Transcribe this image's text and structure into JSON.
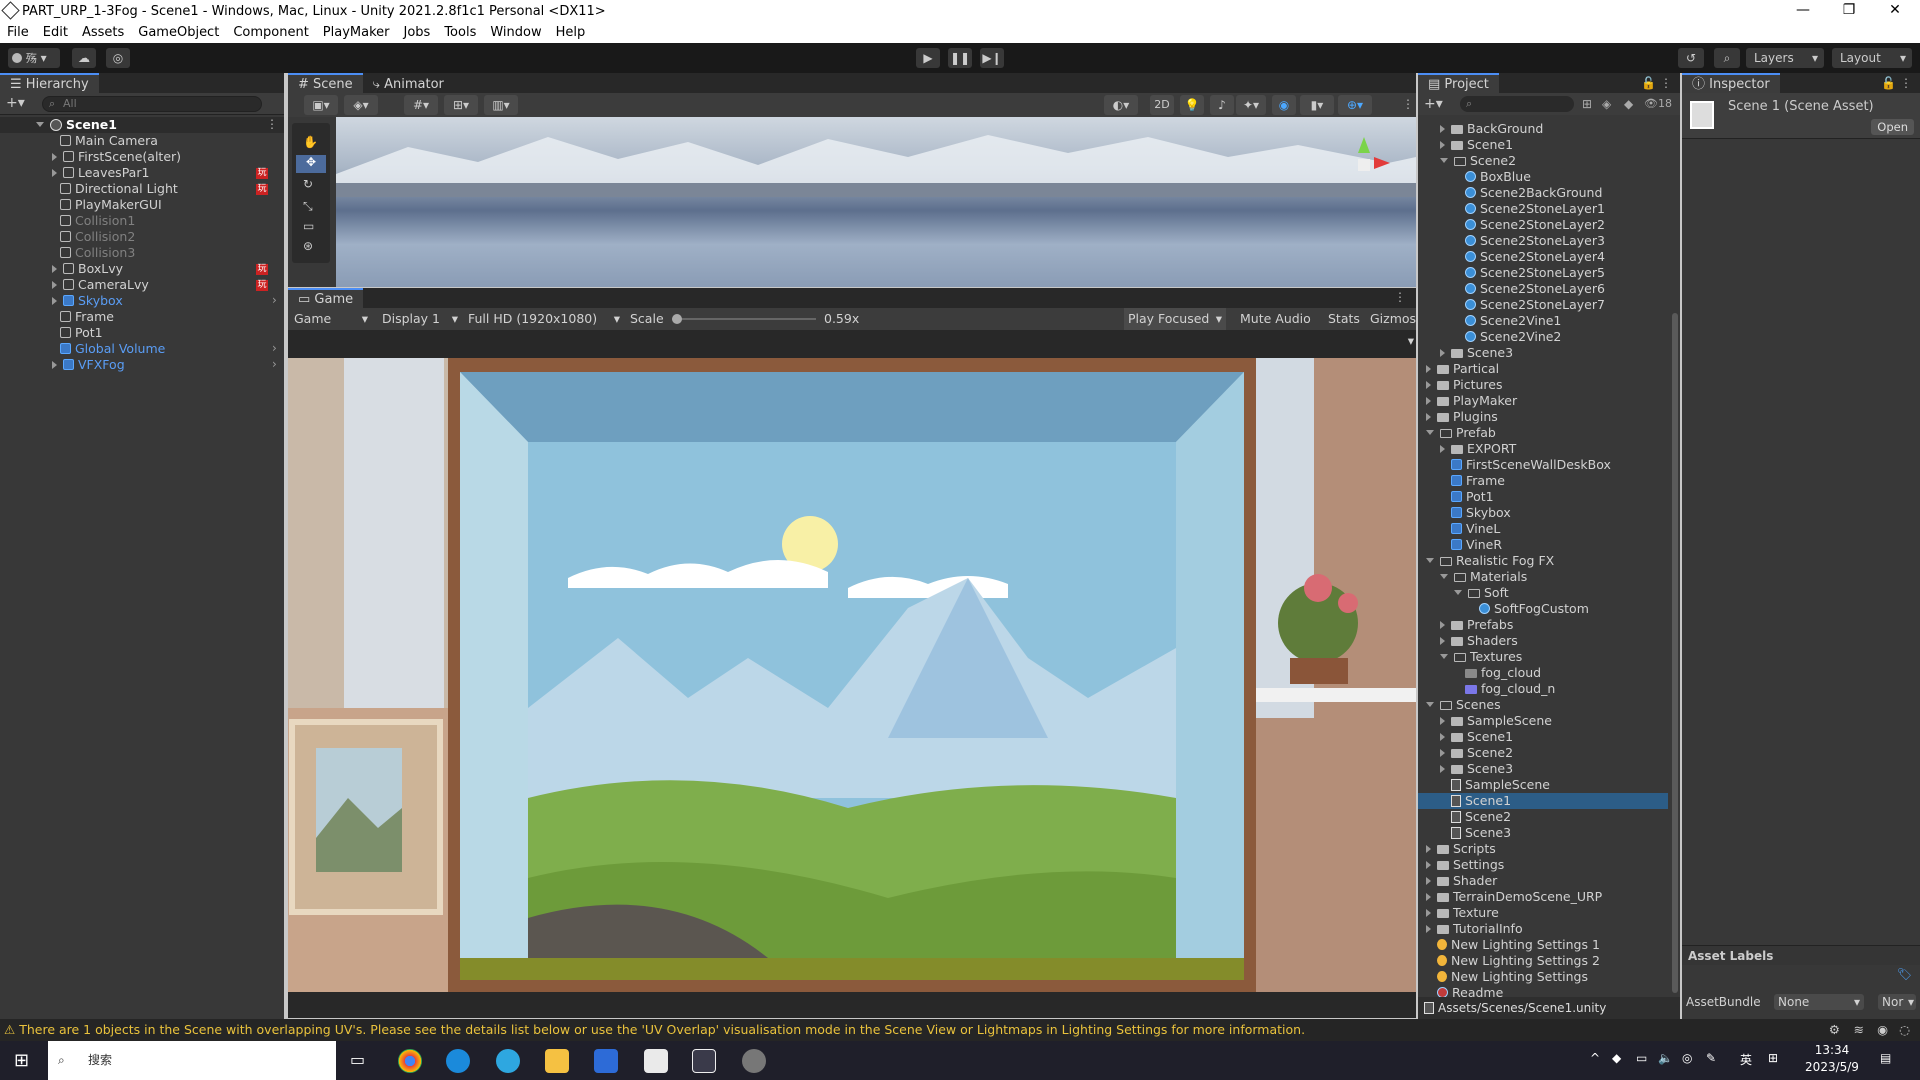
{
  "window": {
    "title": "PART_URP_1-3Fog - Scene1 - Windows, Mac, Linux - Unity 2021.2.8f1c1 Personal <DX11>",
    "controls": [
      "—",
      "❐",
      "✕"
    ]
  },
  "menu": [
    "File",
    "Edit",
    "Assets",
    "GameObject",
    "Component",
    "PlayMaker",
    "Jobs",
    "Tools",
    "Window",
    "Help"
  ],
  "toolbar": {
    "account": "殇",
    "layers_label": "Layers",
    "layout_label": "Layout"
  },
  "hierarchy": {
    "tab": "Hierarchy",
    "search_placeholder": "All",
    "root": "Scene1",
    "items": [
      {
        "label": "Main Camera",
        "style": "normal"
      },
      {
        "label": "FirstScene(alter)",
        "style": "normal"
      },
      {
        "label": "LeavesPar1",
        "style": "normal"
      },
      {
        "label": "Directional Light",
        "style": "normal"
      },
      {
        "label": "PlayMakerGUI",
        "style": "normal"
      },
      {
        "label": "Collision1",
        "style": "gray"
      },
      {
        "label": "Collision2",
        "style": "gray"
      },
      {
        "label": "Collision3",
        "style": "gray"
      },
      {
        "label": "BoxLvy",
        "style": "normal"
      },
      {
        "label": "CameraLvy",
        "style": "normal"
      },
      {
        "label": "Skybox",
        "style": "blue"
      },
      {
        "label": "Frame",
        "style": "normal"
      },
      {
        "label": "Pot1",
        "style": "normal"
      },
      {
        "label": "Global Volume",
        "style": "blue"
      },
      {
        "label": "VFXFog",
        "style": "blue"
      }
    ],
    "badge": "玩"
  },
  "scene_view": {
    "tabs": [
      "Scene",
      "Animator"
    ],
    "mode_2d": "2D"
  },
  "game_view": {
    "tab": "Game",
    "mode": "Game",
    "display": "Display 1",
    "resolution": "Full HD (1920x1080)",
    "scale_label": "Scale",
    "scale_value": "0.59x",
    "scale_fraction": 0.0,
    "play_focused": "Play Focused",
    "mute_audio": "Mute Audio",
    "stats": "Stats",
    "gizmos": "Gizmos"
  },
  "project": {
    "tab": "Project",
    "count": "18",
    "items": [
      {
        "label": "BackGround",
        "icon": "folder",
        "indent": 2,
        "arrow": "right"
      },
      {
        "label": "Scene1",
        "icon": "folder",
        "indent": 2,
        "arrow": "right"
      },
      {
        "label": "Scene2",
        "icon": "folder-open",
        "indent": 2,
        "arrow": "down"
      },
      {
        "label": "BoxBlue",
        "icon": "sphere",
        "indent": 3,
        "arrow": ""
      },
      {
        "label": "Scene2BackGround",
        "icon": "sphere",
        "indent": 3,
        "arrow": ""
      },
      {
        "label": "Scene2StoneLayer1",
        "icon": "sphere",
        "indent": 3,
        "arrow": ""
      },
      {
        "label": "Scene2StoneLayer2",
        "icon": "sphere",
        "indent": 3,
        "arrow": ""
      },
      {
        "label": "Scene2StoneLayer3",
        "icon": "sphere",
        "indent": 3,
        "arrow": ""
      },
      {
        "label": "Scene2StoneLayer4",
        "icon": "sphere",
        "indent": 3,
        "arrow": ""
      },
      {
        "label": "Scene2StoneLayer5",
        "icon": "sphere",
        "indent": 3,
        "arrow": ""
      },
      {
        "label": "Scene2StoneLayer6",
        "icon": "sphere",
        "indent": 3,
        "arrow": ""
      },
      {
        "label": "Scene2StoneLayer7",
        "icon": "sphere",
        "indent": 3,
        "arrow": ""
      },
      {
        "label": "Scene2Vine1",
        "icon": "sphere",
        "indent": 3,
        "arrow": ""
      },
      {
        "label": "Scene2Vine2",
        "icon": "sphere",
        "indent": 3,
        "arrow": ""
      },
      {
        "label": "Scene3",
        "icon": "folder",
        "indent": 2,
        "arrow": "right"
      },
      {
        "label": "Partical",
        "icon": "folder",
        "indent": 1,
        "arrow": "right"
      },
      {
        "label": "Pictures",
        "icon": "folder",
        "indent": 1,
        "arrow": "right"
      },
      {
        "label": "PlayMaker",
        "icon": "folder",
        "indent": 1,
        "arrow": "right"
      },
      {
        "label": "Plugins",
        "icon": "folder",
        "indent": 1,
        "arrow": "right"
      },
      {
        "label": "Prefab",
        "icon": "folder-open",
        "indent": 1,
        "arrow": "down"
      },
      {
        "label": "EXPORT",
        "icon": "folder",
        "indent": 2,
        "arrow": "right"
      },
      {
        "label": "FirstSceneWallDeskBox",
        "icon": "cube",
        "indent": 2,
        "arrow": ""
      },
      {
        "label": "Frame",
        "icon": "cube",
        "indent": 2,
        "arrow": ""
      },
      {
        "label": "Pot1",
        "icon": "cube",
        "indent": 2,
        "arrow": ""
      },
      {
        "label": "Skybox",
        "icon": "cube",
        "indent": 2,
        "arrow": ""
      },
      {
        "label": "VineL",
        "icon": "cube",
        "indent": 2,
        "arrow": ""
      },
      {
        "label": "VineR",
        "icon": "cube",
        "indent": 2,
        "arrow": ""
      },
      {
        "label": "Realistic Fog FX",
        "icon": "folder-open",
        "indent": 1,
        "arrow": "down"
      },
      {
        "label": "Materials",
        "icon": "folder-open",
        "indent": 2,
        "arrow": "down"
      },
      {
        "label": "Soft",
        "icon": "folder-open",
        "indent": 3,
        "arrow": "down"
      },
      {
        "label": "SoftFogCustom",
        "icon": "sphere",
        "indent": 4,
        "arrow": ""
      },
      {
        "label": "Prefabs",
        "icon": "folder",
        "indent": 2,
        "arrow": "right"
      },
      {
        "label": "Shaders",
        "icon": "folder",
        "indent": 2,
        "arrow": "right"
      },
      {
        "label": "Textures",
        "icon": "folder-open",
        "indent": 2,
        "arrow": "down"
      },
      {
        "label": "fog_cloud",
        "icon": "texture",
        "indent": 3,
        "arrow": ""
      },
      {
        "label": "fog_cloud_n",
        "icon": "texture-n",
        "indent": 3,
        "arrow": ""
      },
      {
        "label": "Scenes",
        "icon": "folder-open",
        "indent": 1,
        "arrow": "down"
      },
      {
        "label": "SampleScene",
        "icon": "folder",
        "indent": 2,
        "arrow": "right"
      },
      {
        "label": "Scene1",
        "icon": "folder",
        "indent": 2,
        "arrow": "right"
      },
      {
        "label": "Scene2",
        "icon": "folder",
        "indent": 2,
        "arrow": "right"
      },
      {
        "label": "Scene3",
        "icon": "folder",
        "indent": 2,
        "arrow": "right"
      },
      {
        "label": "SampleScene",
        "icon": "scene",
        "indent": 2,
        "arrow": ""
      },
      {
        "label": "Scene1",
        "icon": "scene",
        "indent": 2,
        "arrow": "",
        "selected": true
      },
      {
        "label": "Scene2",
        "icon": "scene",
        "indent": 2,
        "arrow": ""
      },
      {
        "label": "Scene3",
        "icon": "scene",
        "indent": 2,
        "arrow": ""
      },
      {
        "label": "Scripts",
        "icon": "folder",
        "indent": 1,
        "arrow": "right"
      },
      {
        "label": "Settings",
        "icon": "folder",
        "indent": 1,
        "arrow": "right"
      },
      {
        "label": "Shader",
        "icon": "folder",
        "indent": 1,
        "arrow": "right"
      },
      {
        "label": "TerrainDemoScene_URP",
        "icon": "folder",
        "indent": 1,
        "arrow": "right"
      },
      {
        "label": "Texture",
        "icon": "folder",
        "indent": 1,
        "arrow": "right"
      },
      {
        "label": "TutorialInfo",
        "icon": "folder",
        "indent": 1,
        "arrow": "right"
      },
      {
        "label": "New Lighting Settings 1",
        "icon": "bulb",
        "indent": 1,
        "arrow": ""
      },
      {
        "label": "New Lighting Settings 2",
        "icon": "bulb",
        "indent": 1,
        "arrow": ""
      },
      {
        "label": "New Lighting Settings",
        "icon": "bulb",
        "indent": 1,
        "arrow": ""
      },
      {
        "label": "Readme",
        "icon": "readme",
        "indent": 1,
        "arrow": ""
      }
    ],
    "path": "Assets/Scenes/Scene1.unity"
  },
  "inspector": {
    "tab": "Inspector",
    "title": "Scene 1 (Scene Asset)",
    "open_button": "Open",
    "asset_labels": "Asset Labels",
    "assetbundle_label": "AssetBundle",
    "assetbundle_value": "None",
    "variant_value": "Nor"
  },
  "status": {
    "message": "There are 1 objects in the Scene with overlapping UV's. Please see the details list below or use the 'UV Overlap' visualisation mode in the Scene View or Lightmaps in Lighting Settings for more information."
  },
  "taskbar": {
    "search_placeholder": "搜索",
    "time": "13:34",
    "date": "2023/5/9",
    "ime": "英"
  }
}
